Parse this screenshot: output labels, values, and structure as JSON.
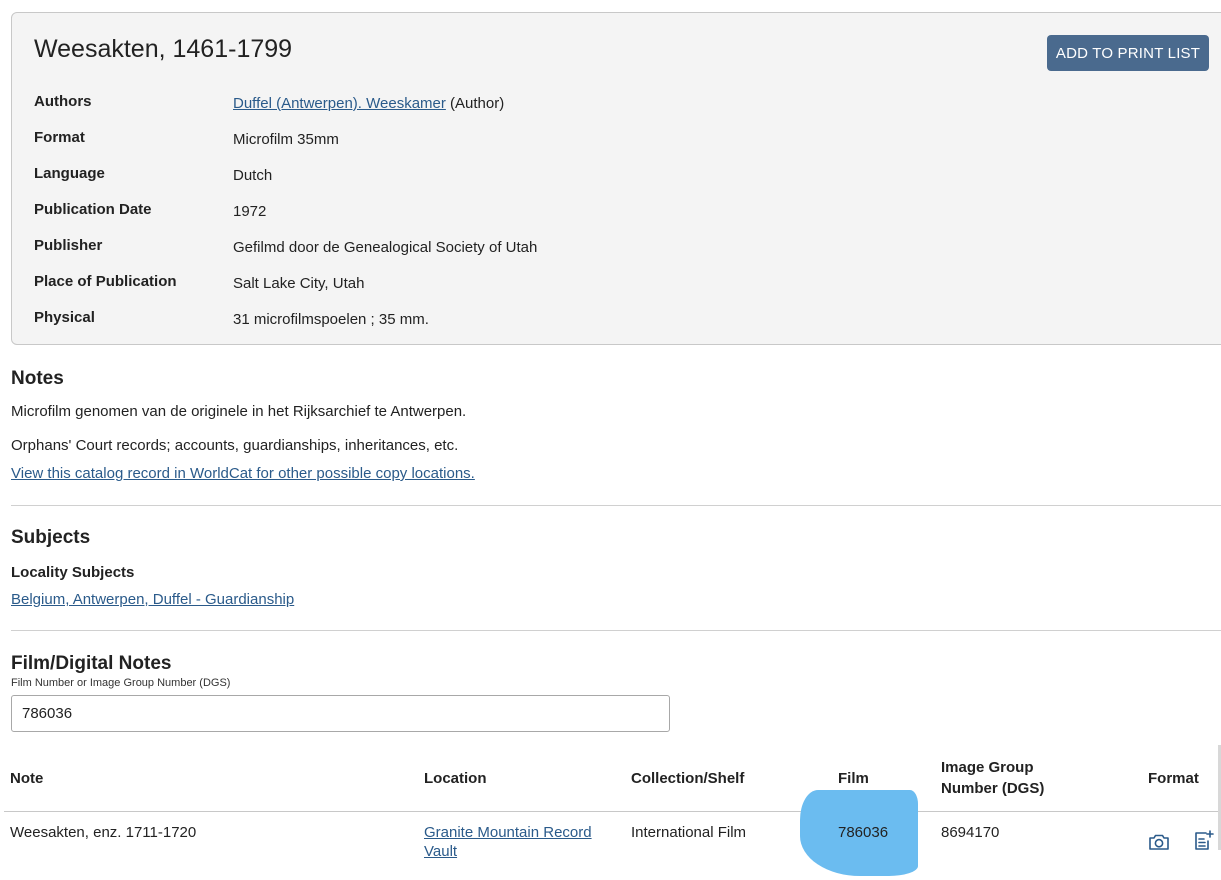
{
  "record": {
    "title": "Weesakten, 1461-1799",
    "print_button": "ADD TO PRINT LIST",
    "details": [
      {
        "label": "Authors",
        "link": "Duffel (Antwerpen). Weeskamer",
        "suffix": " (Author)"
      },
      {
        "label": "Format",
        "value": "Microfilm 35mm"
      },
      {
        "label": "Language",
        "value": "Dutch"
      },
      {
        "label": "Publication Date",
        "value": "1972"
      },
      {
        "label": "Publisher",
        "value": "Gefilmd door de Genealogical Society of Utah"
      },
      {
        "label": "Place of Publication",
        "value": "Salt Lake City, Utah"
      },
      {
        "label": "Physical",
        "value": "31 microfilmspoelen ; 35 mm."
      }
    ]
  },
  "notes": {
    "heading": "Notes",
    "lines": [
      "Microfilm genomen van de originele in het Rijksarchief te Antwerpen.",
      "Orphans' Court records; accounts, guardianships, inheritances, etc."
    ],
    "worldcat_link": "View this catalog record in WorldCat for other possible copy locations."
  },
  "subjects": {
    "heading": "Subjects",
    "subheading": "Locality Subjects",
    "link": "Belgium, Antwerpen, Duffel - Guardianship"
  },
  "film_notes": {
    "heading": "Film/Digital Notes",
    "input_label": "Film Number or Image Group Number (DGS)",
    "input_value": "786036",
    "columns": {
      "note": "Note",
      "location": "Location",
      "collection": "Collection/Shelf",
      "film": "Film",
      "dgs_line1": "Image Group",
      "dgs_line2": "Number (DGS)",
      "format": "Format"
    },
    "rows": [
      {
        "note": "Weesakten, enz. 1711-1720",
        "location_line1": "Granite Mountain Record",
        "location_line2": "Vault",
        "collection": "International Film",
        "film": "786036",
        "dgs": "8694170",
        "format_icons": [
          "camera-icon",
          "catalog-note-icon"
        ]
      }
    ]
  },
  "colors": {
    "accent_button": "#4a6a8e",
    "link": "#2a5a8a",
    "highlight": "#6bbcf0",
    "card_bg": "#f4f4f4"
  }
}
